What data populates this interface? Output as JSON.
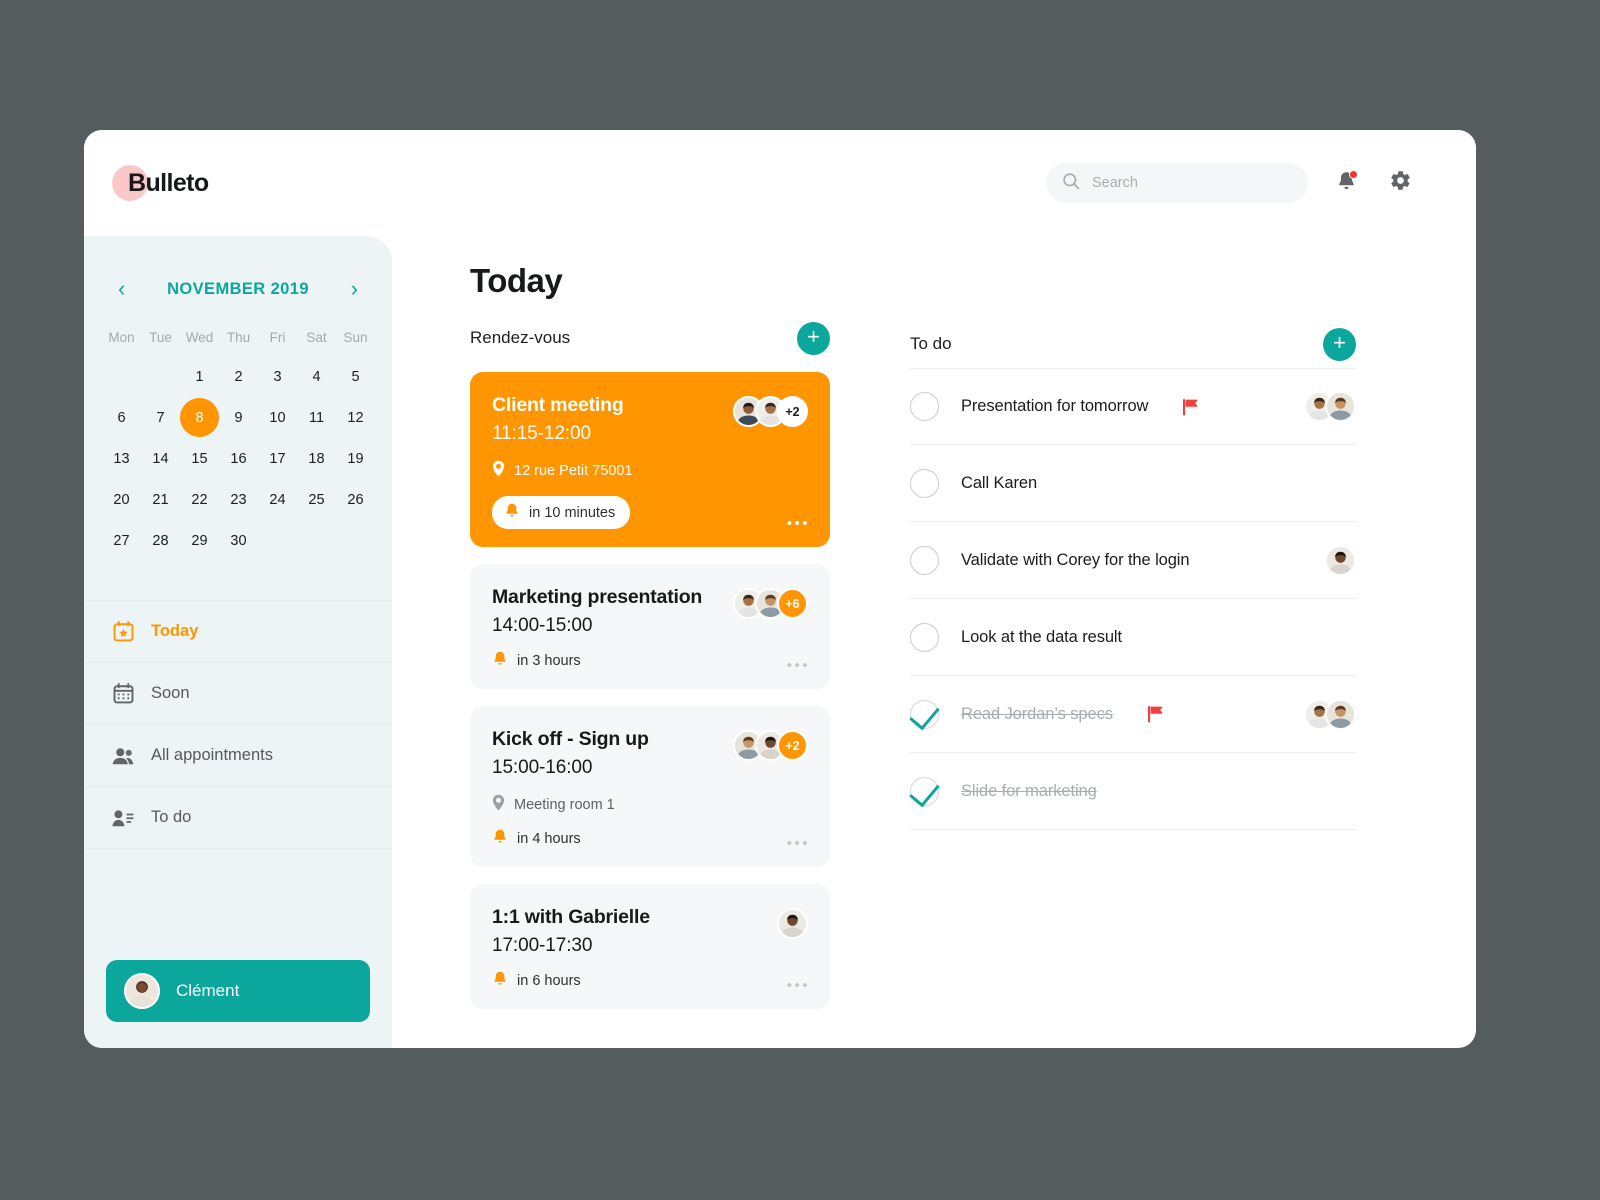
{
  "app": {
    "logo_text": "Bulleto"
  },
  "topbar": {
    "search_placeholder": "Search",
    "search_value": "",
    "notifications_icon": "bell-icon",
    "settings_icon": "gear-icon"
  },
  "sidebar": {
    "calendar": {
      "prev_label": "‹",
      "next_label": "›",
      "month_title": "NOVEMBER 2019",
      "day_headers": [
        "Mon",
        "Tue",
        "Wed",
        "Thu",
        "Fri",
        "Sat",
        "Sun"
      ],
      "leading_blanks": 2,
      "days": [
        1,
        2,
        3,
        4,
        5,
        6,
        7,
        8,
        9,
        10,
        11,
        12,
        13,
        14,
        15,
        16,
        17,
        18,
        19,
        20,
        21,
        22,
        23,
        24,
        25,
        26,
        27,
        28,
        29,
        30
      ],
      "selected_day": 8
    },
    "nav_items": [
      {
        "label": "Today",
        "icon": "calendar-star-icon",
        "active": true
      },
      {
        "label": "Soon",
        "icon": "calendar-icon",
        "active": false
      },
      {
        "label": "All appointments",
        "icon": "people-icon",
        "active": false
      },
      {
        "label": "To do",
        "icon": "person-list-icon",
        "active": false
      }
    ],
    "profile": {
      "name": "Clément",
      "avatar": "user-avatar"
    }
  },
  "main": {
    "page_title": "Today",
    "appointments": {
      "section_title": "Rendez-vous",
      "add_label": "+",
      "items": [
        {
          "title": "Client meeting",
          "time": "11:15-12:00",
          "location": "12 rue Petit 75001",
          "reminder": "in 10 minutes",
          "highlight": true,
          "avatars": 2,
          "more_count": "+2",
          "menu_label": "•••"
        },
        {
          "title": "Marketing presentation",
          "time": "14:00-15:00",
          "location": "",
          "reminder": "in 3 hours",
          "highlight": false,
          "avatars": 2,
          "more_count": "+6",
          "menu_label": "•••"
        },
        {
          "title": "Kick off - Sign up",
          "time": "15:00-16:00",
          "location": "Meeting room 1",
          "reminder": "in 4 hours",
          "highlight": false,
          "avatars": 2,
          "more_count": "+2",
          "menu_label": "•••"
        },
        {
          "title": "1:1 with Gabrielle",
          "time": "17:00-17:30",
          "location": "",
          "reminder": "in 6 hours",
          "highlight": false,
          "avatars": 1,
          "more_count": "",
          "menu_label": "•••"
        }
      ]
    },
    "todo": {
      "section_title": "To do",
      "add_label": "+",
      "items": [
        {
          "label": "Presentation for tomorrow",
          "done": false,
          "flagged": true,
          "avatars": 2
        },
        {
          "label": "Call Karen",
          "done": false,
          "flagged": false,
          "avatars": 0
        },
        {
          "label": "Validate with Corey for the login",
          "done": false,
          "flagged": false,
          "avatars": 1
        },
        {
          "label": "Look at the data result",
          "done": false,
          "flagged": false,
          "avatars": 0
        },
        {
          "label": "Read Jordan’s specs",
          "done": true,
          "flagged": true,
          "avatars": 2
        },
        {
          "label": "Slide for marketing",
          "done": true,
          "flagged": false,
          "avatars": 0
        }
      ]
    }
  },
  "colors": {
    "accent_teal": "#0BA79C",
    "accent_orange": "#FF9500",
    "flag_red": "#F8312F",
    "page_background": "#545C5E",
    "sidebar_background": "#ECF4F5",
    "logo_dot": "#FBC8CA"
  }
}
